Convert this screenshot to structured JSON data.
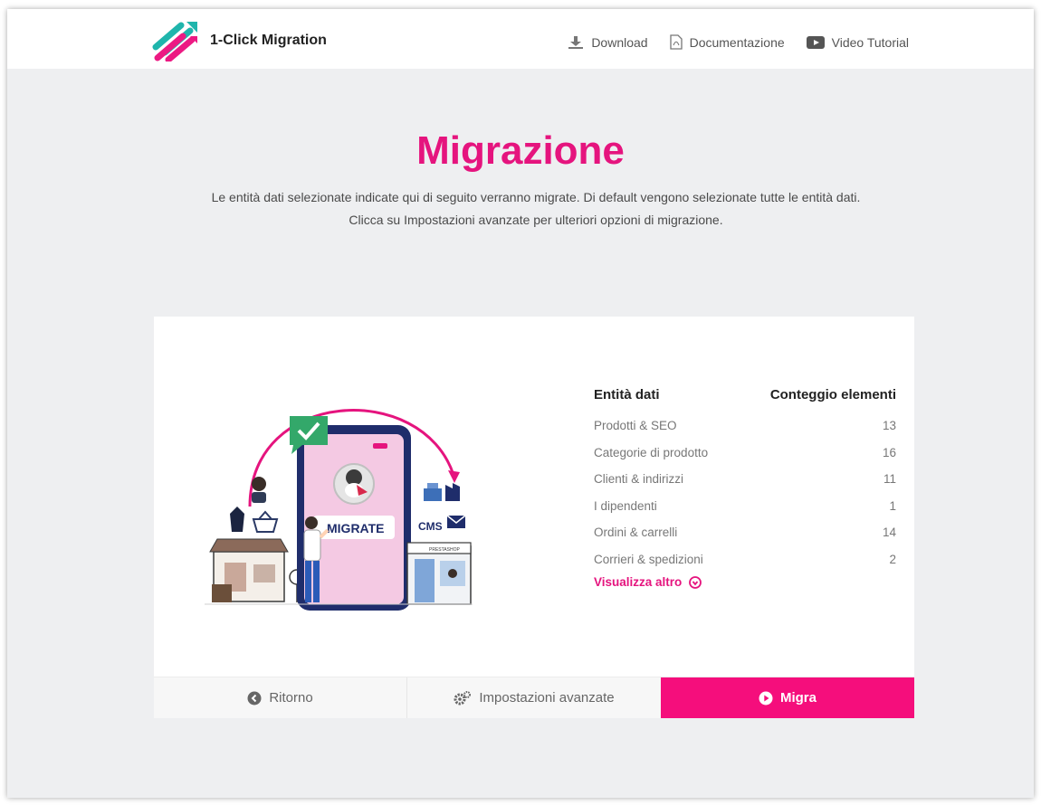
{
  "header": {
    "brand": "1-Click Migration",
    "nav": [
      {
        "label": "Download"
      },
      {
        "label": "Documentazione"
      },
      {
        "label": "Video Tutorial"
      }
    ]
  },
  "page": {
    "title": "Migrazione",
    "description_line1": "Le entità dati selezionate indicate qui di seguito verranno migrate. Di default vengono selezionate tutte le entità dati.",
    "description_line2": "Clicca su Impostazioni avanzate per ulteriori opzioni di migrazione."
  },
  "illustration": {
    "phone_label": "MIGRATE",
    "cms_label": "CMS",
    "store_label": "PRESTASHOP"
  },
  "table": {
    "col_entity": "Entità dati",
    "col_count": "Conteggio elementi",
    "rows": [
      {
        "name": "Prodotti & SEO",
        "count": "13"
      },
      {
        "name": "Categorie di prodotto",
        "count": "16"
      },
      {
        "name": "Clienti & indirizzi",
        "count": "11"
      },
      {
        "name": "I dipendenti",
        "count": "1"
      },
      {
        "name": "Ordini & carrelli",
        "count": "14"
      },
      {
        "name": "Corrieri & spedizioni",
        "count": "2"
      }
    ],
    "more": "Visualizza altro"
  },
  "footer": {
    "back": "Ritorno",
    "advanced": "Impostazioni avanzate",
    "migrate": "Migra"
  },
  "colors": {
    "accent": "#e5147e",
    "button": "#f50e7c",
    "background": "#eeeff1"
  }
}
